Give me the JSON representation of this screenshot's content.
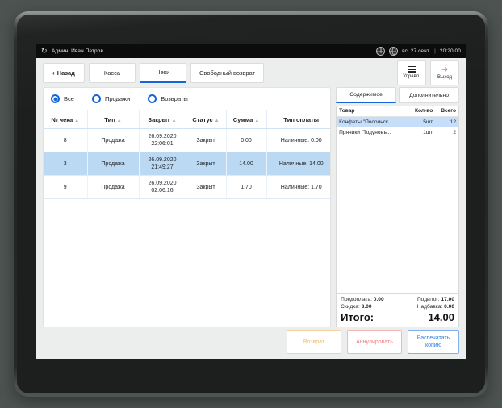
{
  "statusbar": {
    "sync_icon": "sync-icon",
    "user_label": "Админ: Иван Петров",
    "icon1": "network-icon",
    "icon2": "globe-icon",
    "date": "вс, 27 сент.",
    "separator": "|",
    "time": "20:20:00"
  },
  "toolbar": {
    "back_label": "Назад",
    "back_chevron": "‹",
    "tabs": [
      {
        "label": "Касса",
        "active": false
      },
      {
        "label": "Чеки",
        "active": true
      },
      {
        "label": "Свободный возврат",
        "active": false
      }
    ],
    "manage_label": "Управл.",
    "manage_icon": "hamburger-icon",
    "exit_label": "Выход",
    "exit_icon": "exit-icon"
  },
  "filters": {
    "options": [
      {
        "label": "Все",
        "selected": true
      },
      {
        "label": "Продажи",
        "selected": false
      },
      {
        "label": "Возвраты",
        "selected": false
      }
    ]
  },
  "checks_table": {
    "headers": [
      "№ чека",
      "Тип",
      "Закрыт",
      "Статус",
      "Сумма",
      "Тип оплаты"
    ],
    "sort_arrow": "▲",
    "rows": [
      {
        "number": "8",
        "type": "Продажа",
        "closed_date": "26.09.2020",
        "closed_time": "22:06:01",
        "status": "Закрыт",
        "sum": "0.00",
        "payment": "Наличные: 0.00",
        "selected": false
      },
      {
        "number": "3",
        "type": "Продажа",
        "closed_date": "26.09.2020",
        "closed_time": "21:49:27",
        "status": "Закрыт",
        "sum": "14.00",
        "payment": "Наличные: 14.00",
        "selected": true
      },
      {
        "number": "9",
        "type": "Продажа",
        "closed_date": "26.09.2020",
        "closed_time": "02:06:16",
        "status": "Закрыт",
        "sum": "1.70",
        "payment": "Наличные: 1.70",
        "selected": false
      }
    ]
  },
  "right_panel": {
    "tabs": [
      {
        "label": "Содержимое",
        "active": true
      },
      {
        "label": "Дополнительно",
        "active": false
      }
    ],
    "items_headers": [
      "Товар",
      "Кол-во",
      "Всего"
    ],
    "items": [
      {
        "name": "Конфеты \"Посольск...",
        "qty": "5шт",
        "total": "12",
        "selected": true
      },
      {
        "name": "Пряники \"Тодуновъ...",
        "qty": "1шт",
        "total": "2",
        "selected": false
      }
    ],
    "totals": {
      "prepay_label": "Предоплата:",
      "prepay_value": "0.00",
      "subtotal_label": "Подытог:",
      "subtotal_value": "17.00",
      "discount_label": "Скидка:",
      "discount_value": "3.00",
      "markup_label": "Надбавка:",
      "markup_value": "0.00",
      "grand_label": "Итого:",
      "grand_value": "14.00"
    }
  },
  "actions": {
    "return_label": "Возврат",
    "annul_label": "Аннулировать",
    "print_line1": "Распечатать",
    "print_line2": "копию"
  },
  "colors": {
    "accent": "#1565d8",
    "row_selected": "#bbd9f2",
    "return": "#f0b865",
    "annul": "#ef7d7d",
    "print": "#2a7fe0",
    "statusbar_bg": "#0c0c0c"
  }
}
